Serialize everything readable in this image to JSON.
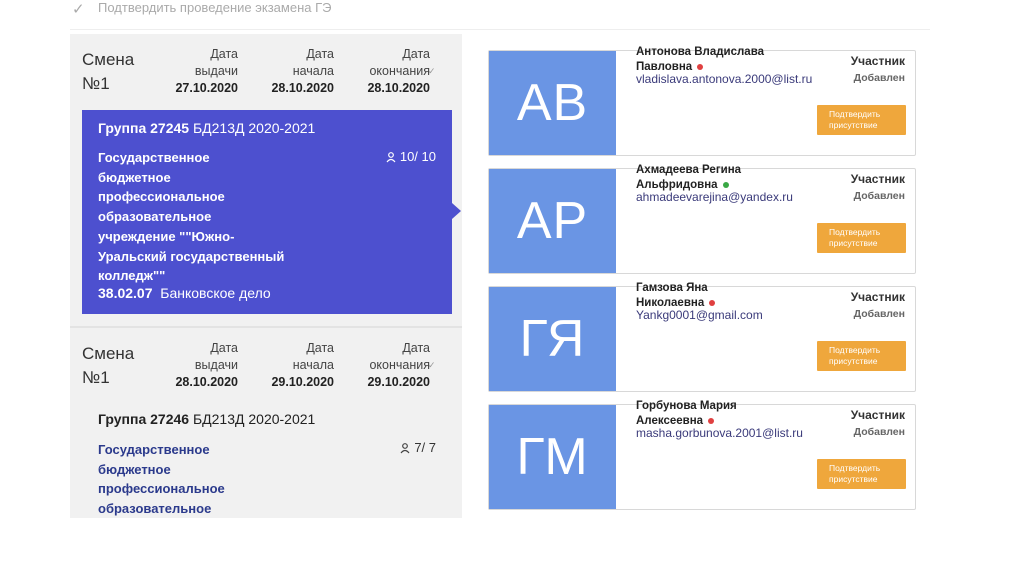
{
  "header": {
    "check_icon": "✓",
    "title": "Подтвердить проведение экзамена ГЭ"
  },
  "shifts": [
    {
      "label_line1": "Смена",
      "label_line2": "№1",
      "issue": {
        "l1": "Дата",
        "l2": "выдачи",
        "value": "27.10.2020"
      },
      "start": {
        "l1": "Дата",
        "l2": "начала",
        "value": "28.10.2020"
      },
      "end": {
        "l1": "Дата",
        "l2": "окончания",
        "value": "28.10.2020"
      },
      "group": {
        "name_bold": "Группа 27245",
        "name_rest": "БД213Д 2020-2021",
        "org_lines": [
          "Государственное",
          "бюджетное",
          "профессиональное",
          "образовательное",
          "учреждение \"\"Южно-",
          "Уральский государственный",
          "колледж\"\""
        ],
        "spec_code": "38.02.07",
        "spec_name": "Банковское дело",
        "count": "10/ 10"
      }
    },
    {
      "label_line1": "Смена",
      "label_line2": "№1",
      "issue": {
        "l1": "Дата",
        "l2": "выдачи",
        "value": "28.10.2020"
      },
      "start": {
        "l1": "Дата",
        "l2": "начала",
        "value": "29.10.2020"
      },
      "end": {
        "l1": "Дата",
        "l2": "окончания",
        "value": "29.10.2020"
      },
      "group": {
        "name_bold": "Группа 27246",
        "name_rest": "БД213Д 2020-2021",
        "org_lines": [
          "Государственное",
          "бюджетное",
          "профессиональное",
          "образовательное"
        ],
        "count": "7/ 7"
      }
    }
  ],
  "participants": [
    {
      "initials": "АВ",
      "name_line1": "Антонова Владислава",
      "name_line2": "Павловна",
      "status_color": "#e04040",
      "email": "vladislava.antonova.2000@list.ru",
      "role": "Участник",
      "status": "Добавлен",
      "button_line1": "Подтвердить",
      "button_line2": "присутствие"
    },
    {
      "initials": "АР",
      "name_line1": "Ахмадеева Регина",
      "name_line2": "Альфридовна",
      "status_color": "#3aa845",
      "email": "ahmadeevarejina@yandex.ru",
      "role": "Участник",
      "status": "Добавлен",
      "button_line1": "Подтвердить",
      "button_line2": "присутствие"
    },
    {
      "initials": "ГЯ",
      "name_line1": "Гамзова Яна",
      "name_line2": "Николаевна",
      "status_color": "#e04040",
      "email": "Yankg0001@gmail.com",
      "role": "Участник",
      "status": "Добавлен",
      "button_line1": "Подтвердить",
      "button_line2": "присутствие"
    },
    {
      "initials": "ГМ",
      "name_line1": "Горбунова Мария",
      "name_line2": "Алексеевна",
      "status_color": "#e04040",
      "email": "masha.gorbunova.2001@list.ru",
      "role": "Участник",
      "status": "Добавлен",
      "button_line1": "Подтвердить",
      "button_line2": "присутствие"
    }
  ]
}
